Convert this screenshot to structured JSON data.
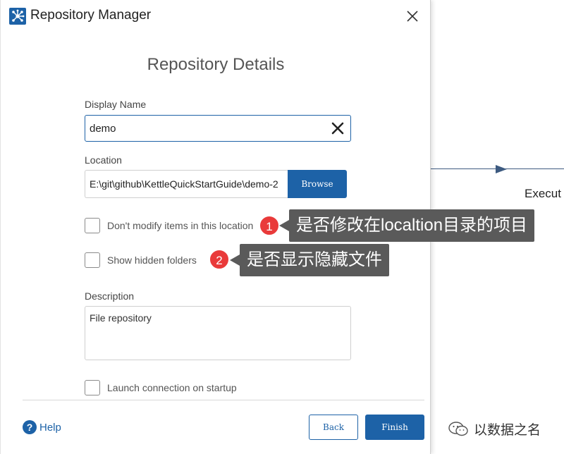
{
  "window": {
    "title": "Repository Manager"
  },
  "heading": "Repository Details",
  "display_name": {
    "label": "Display Name",
    "value": "demo"
  },
  "location": {
    "label": "Location",
    "value": "E:\\git\\github\\KettleQuickStartGuide\\demo-2",
    "browse_label": "Browse"
  },
  "options": {
    "dont_modify_label": "Don't modify items in this location",
    "show_hidden_label": "Show hidden folders",
    "launch_label": "Launch connection on startup"
  },
  "description": {
    "label": "Description",
    "value": "File repository"
  },
  "footer": {
    "help_label": "Help",
    "back_label": "Back",
    "finish_label": "Finish"
  },
  "annotations": [
    {
      "number": "1",
      "text": "是否修改在localtion目录的项目"
    },
    {
      "number": "2",
      "text": "是否显示隐藏文件"
    }
  ],
  "background": {
    "step_label": "Execut"
  },
  "watermark": {
    "text": "以数据之名"
  },
  "colors": {
    "accent": "#1d62a7",
    "badge": "#e93a3a",
    "callout": "#5a5a5a"
  },
  "icons": {
    "app": "network-icon",
    "close": "close-icon",
    "clear": "clear-icon",
    "help": "help-icon",
    "wechat": "wechat-icon"
  }
}
